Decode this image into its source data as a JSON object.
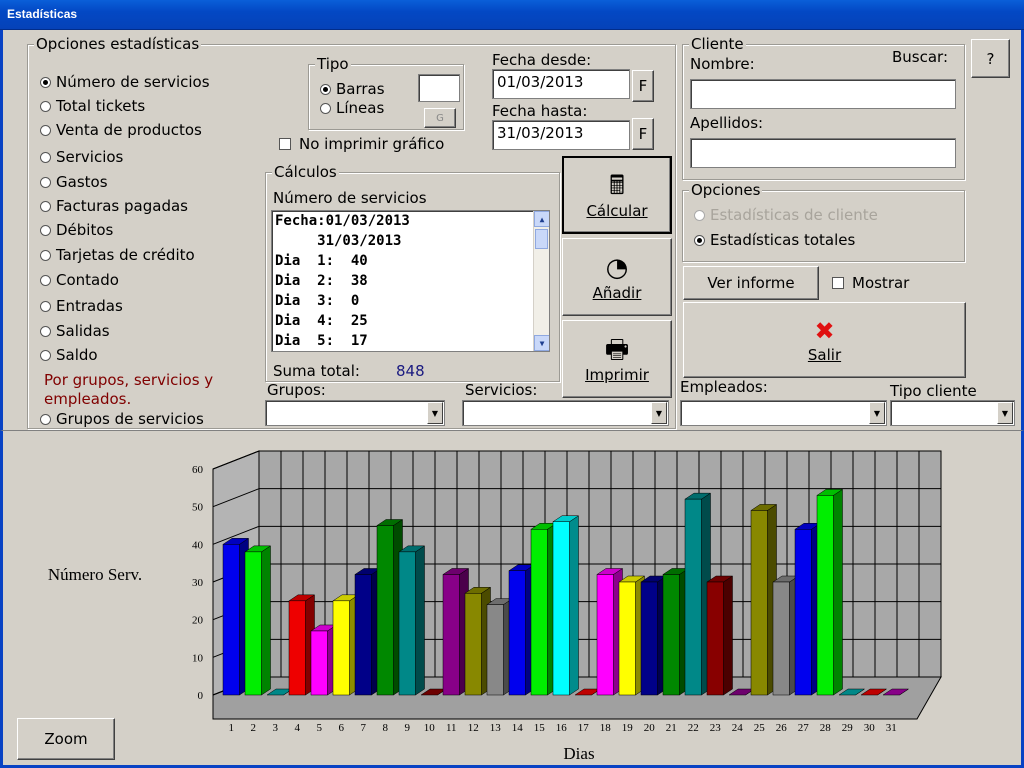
{
  "window": {
    "title": "Estadísticas"
  },
  "options_group": {
    "legend": "Opciones estadísticas",
    "items": [
      {
        "label": "Número de servicios",
        "selected": true
      },
      {
        "label": "Total tickets",
        "selected": false
      },
      {
        "label": "Venta de productos",
        "selected": false
      },
      {
        "label": "Servicios",
        "selected": false
      },
      {
        "label": "Gastos",
        "selected": false
      },
      {
        "label": "Facturas pagadas",
        "selected": false
      },
      {
        "label": "Débitos",
        "selected": false
      },
      {
        "label": "Tarjetas de crédito",
        "selected": false
      },
      {
        "label": "Contado",
        "selected": false
      },
      {
        "label": "Entradas",
        "selected": false
      },
      {
        "label": "Salidas",
        "selected": false
      },
      {
        "label": "Saldo",
        "selected": false
      }
    ],
    "note": "Por grupos, servicios y empleados.",
    "groups_item": "Grupos de servicios"
  },
  "tipo": {
    "legend": "Tipo",
    "barras": "Barras",
    "lineas": "Líneas",
    "selected": "Barras",
    "color_button": "G"
  },
  "no_print": "No imprimir gráfico",
  "dates": {
    "from_label": "Fecha desde:",
    "from_value": "01/03/2013",
    "to_label": "Fecha hasta:",
    "to_value": "31/03/2013",
    "picker": "F"
  },
  "calculos": {
    "legend": "Cálculos",
    "heading": "Número de servicios",
    "lines": [
      "Fecha:01/03/2013",
      "     31/03/2013",
      "Dia  1:  40",
      "Dia  2:  38",
      "Dia  3:  0",
      "Dia  4:  25",
      "Dia  5:  17"
    ],
    "sum_label": "Suma total:",
    "sum_value": "848"
  },
  "actions": {
    "calcular": "Cálcular",
    "anadir": "Añadir",
    "imprimir": "Imprimir"
  },
  "cliente": {
    "legend": "Cliente",
    "nombre_label": "Nombre:",
    "buscar_label": "Buscar:",
    "apellidos_label": "Apellidos:",
    "nombre_value": "",
    "apellidos_value": "",
    "help": "?"
  },
  "opciones": {
    "legend": "Opciones",
    "cliente": "Estadísticas de cliente",
    "totales": "Estadísticas totales"
  },
  "ver_informe": "Ver informe",
  "mostrar": "Mostrar",
  "salir": "Salir",
  "filters": {
    "grupos": "Grupos:",
    "servicios": "Servicios:",
    "empleados": "Empleados:",
    "tipo_cliente": "Tipo cliente"
  },
  "zoom": "Zoom",
  "chart_data": {
    "type": "bar",
    "ylabel": "Número Serv.",
    "xlabel": "Dias",
    "ylim": [
      0,
      60
    ],
    "yticks": [
      0,
      10,
      20,
      30,
      40,
      50,
      60
    ],
    "categories": [
      "1",
      "2",
      "3",
      "4",
      "5",
      "6",
      "7",
      "8",
      "9",
      "10",
      "11",
      "12",
      "13",
      "14",
      "15",
      "16",
      "17",
      "18",
      "19",
      "20",
      "21",
      "22",
      "23",
      "24",
      "25",
      "26",
      "27",
      "28",
      "29",
      "30",
      "31"
    ],
    "values": [
      40,
      38,
      0,
      25,
      17,
      25,
      32,
      45,
      38,
      0,
      32,
      27,
      24,
      33,
      44,
      46,
      0,
      32,
      30,
      30,
      32,
      52,
      30,
      0,
      49,
      30,
      44,
      53,
      0,
      0,
      0
    ],
    "colors": [
      "#0000ee",
      "#00ee00",
      "#00aaaa",
      "#ee0000",
      "#ff00ff",
      "#ffff00",
      "#000088",
      "#008800",
      "#008888",
      "#880000",
      "#880088",
      "#888800",
      "#888888",
      "#0000ee",
      "#00ee00",
      "#00ffff",
      "#ee0000",
      "#ff00ff",
      "#ffff00",
      "#000088",
      "#008800",
      "#008888",
      "#880000",
      "#880088",
      "#888800",
      "#888888",
      "#0000ee",
      "#00ee00",
      "#00aaaa",
      "#ee0000",
      "#aa00aa"
    ],
    "grid": true,
    "legend": "none"
  }
}
